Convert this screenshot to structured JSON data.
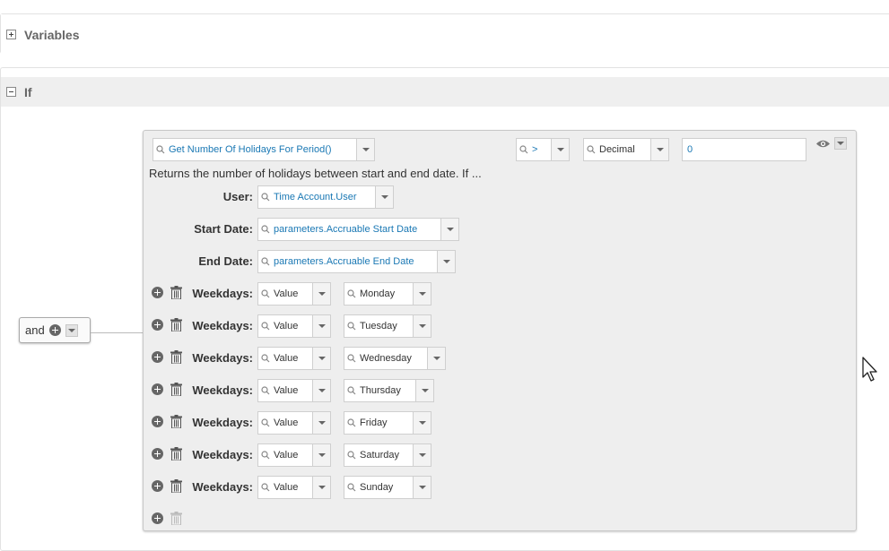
{
  "sections": {
    "variables": {
      "label": "Variables"
    },
    "if": {
      "label": "If"
    }
  },
  "logic": {
    "operator": "and"
  },
  "condition": {
    "function": "Get Number Of Holidays For Period()",
    "comparator": ">",
    "value_type": "Decimal",
    "value": "0",
    "description": "Returns the number of holidays between start and end date. If ..."
  },
  "params": {
    "user": {
      "label": "User:",
      "value": "Time Account.User"
    },
    "start_date": {
      "label": "Start Date:",
      "value": "parameters.Accruable Start Date"
    },
    "end_date": {
      "label": "End Date:",
      "value": "parameters.Accruable End Date"
    }
  },
  "weekday_rows": [
    {
      "label": "Weekdays:",
      "type": "Value",
      "day": "Monday"
    },
    {
      "label": "Weekdays:",
      "type": "Value",
      "day": "Tuesday"
    },
    {
      "label": "Weekdays:",
      "type": "Value",
      "day": "Wednesday"
    },
    {
      "label": "Weekdays:",
      "type": "Value",
      "day": "Thursday"
    },
    {
      "label": "Weekdays:",
      "type": "Value",
      "day": "Friday"
    },
    {
      "label": "Weekdays:",
      "type": "Value",
      "day": "Saturday"
    },
    {
      "label": "Weekdays:",
      "type": "Value",
      "day": "Sunday"
    }
  ],
  "colors": {
    "link_blue": "#1a78b4",
    "panel_bg": "#eeeeee",
    "header_bg": "#efefef"
  },
  "icons": {
    "search": "magnifier-icon",
    "add": "plus-circle-icon",
    "delete": "trash-icon",
    "visibility": "eye-icon",
    "cursor": "mouse-pointer-icon"
  }
}
